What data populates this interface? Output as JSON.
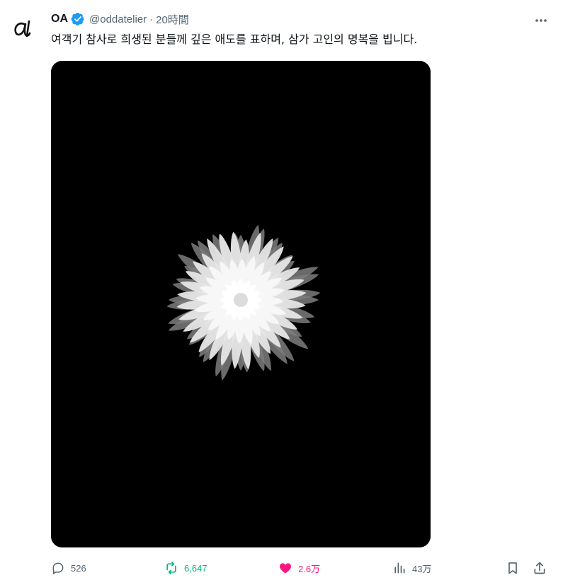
{
  "author": {
    "display_name": "OA",
    "handle": "@oddatelier",
    "separator": "·",
    "timestamp": "20時間",
    "verified": true,
    "avatar_glyph": "α"
  },
  "tweet": {
    "text": "여객기 참사로 희생된 분들께 깊은 애도를 표하며, 삼가 고인의 명복을 빕니다."
  },
  "media": {
    "subject": "white chrysanthemum on black background"
  },
  "actions": {
    "reply_count": "526",
    "retweet_count": "6,647",
    "like_count": "2.6万",
    "view_count": "43万"
  },
  "colors": {
    "verified": "#1d9bf0",
    "retweet_active": "#00ba7c",
    "like_active": "#f91880",
    "muted": "#536471"
  },
  "icons": [
    "more-icon",
    "reply-icon",
    "retweet-icon",
    "like-icon",
    "views-icon",
    "bookmark-icon",
    "share-icon",
    "verified-icon"
  ]
}
